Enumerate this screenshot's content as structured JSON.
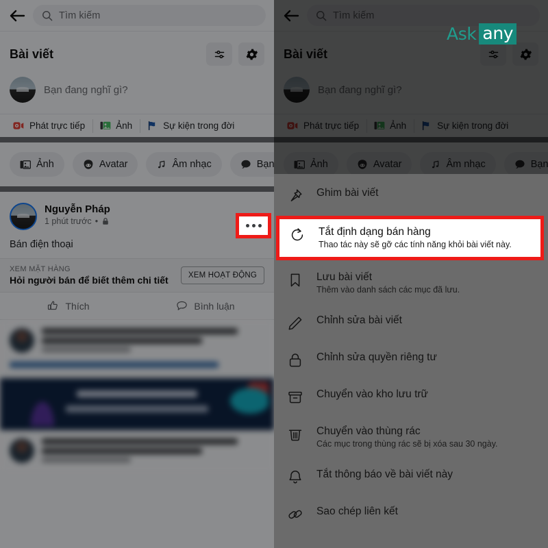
{
  "search": {
    "placeholder": "Tìm kiếm",
    "back_icon": "back-arrow-icon",
    "search_icon": "search-icon"
  },
  "section": {
    "title": "Bài viết",
    "filter_icon": "sliders-icon",
    "settings_icon": "gear-icon"
  },
  "composer": {
    "placeholder": "Bạn đang nghĩ gì?",
    "quick_actions": [
      {
        "label": "Phát trực tiếp",
        "icon": "live-video-icon"
      },
      {
        "label": "Ảnh",
        "icon": "photo-icon"
      },
      {
        "label": "Sự kiện trong đời",
        "icon": "flag-icon"
      }
    ],
    "chips": [
      {
        "label": "Ảnh",
        "icon": "photo-icon"
      },
      {
        "label": "Avatar",
        "icon": "avatar-icon"
      },
      {
        "label": "Âm nhạc",
        "icon": "music-note-icon"
      },
      {
        "label": "Bạn có l",
        "icon": "speech-bubble-icon"
      }
    ]
  },
  "post": {
    "author": "Nguyễn Pháp",
    "time": "1 phút trước",
    "separator": "•",
    "privacy_icon": "lock-icon",
    "more_icon": "three-dots-icon",
    "body": "Bán điện thoại",
    "marketplace": {
      "kicker": "XEM MẶT HÀNG",
      "title": "Hỏi người bán để biết thêm chi tiết",
      "button": "XEM HOẠT ĐỘNG"
    },
    "actions": [
      {
        "label": "Thích",
        "icon": "thumbs-up-icon"
      },
      {
        "label": "Bình luận",
        "icon": "comment-icon"
      }
    ]
  },
  "menu": {
    "items": [
      {
        "label": "Ghim bài viết",
        "desc": "",
        "icon": "pin-icon",
        "highlighted": false
      },
      {
        "label": "Tắt định dạng bán hàng",
        "desc": "Thao tác này sẽ gỡ các tính năng khỏi bài viết này.",
        "icon": "refresh-icon",
        "highlighted": true
      },
      {
        "label": "Lưu bài viết",
        "desc": "Thêm vào danh sách các mục đã lưu.",
        "icon": "bookmark-icon",
        "highlighted": false
      },
      {
        "label": "Chỉnh sửa bài viết",
        "desc": "",
        "icon": "pencil-icon",
        "highlighted": false
      },
      {
        "label": "Chỉnh sửa quyền riêng tư",
        "desc": "",
        "icon": "lock-icon",
        "highlighted": false
      },
      {
        "label": "Chuyển vào kho lưu trữ",
        "desc": "",
        "icon": "archive-icon",
        "highlighted": false
      },
      {
        "label": "Chuyển vào thùng rác",
        "desc": "Các mục trong thùng rác sẽ bị xóa sau 30 ngày.",
        "icon": "trash-icon",
        "highlighted": false
      },
      {
        "label": "Tắt thông báo về bài viết này",
        "desc": "",
        "icon": "bell-icon",
        "highlighted": false
      },
      {
        "label": "Sao chép liên kết",
        "desc": "",
        "icon": "link-icon",
        "highlighted": false
      }
    ]
  },
  "watermark": {
    "part1": "Ask",
    "part2": "any",
    "color": "#17897c"
  },
  "colors": {
    "highlight_red": "#ee1b18",
    "menu_background": "#6b6b6b",
    "app_background": "#f0f2f5",
    "accent_blue": "#1877f2"
  }
}
